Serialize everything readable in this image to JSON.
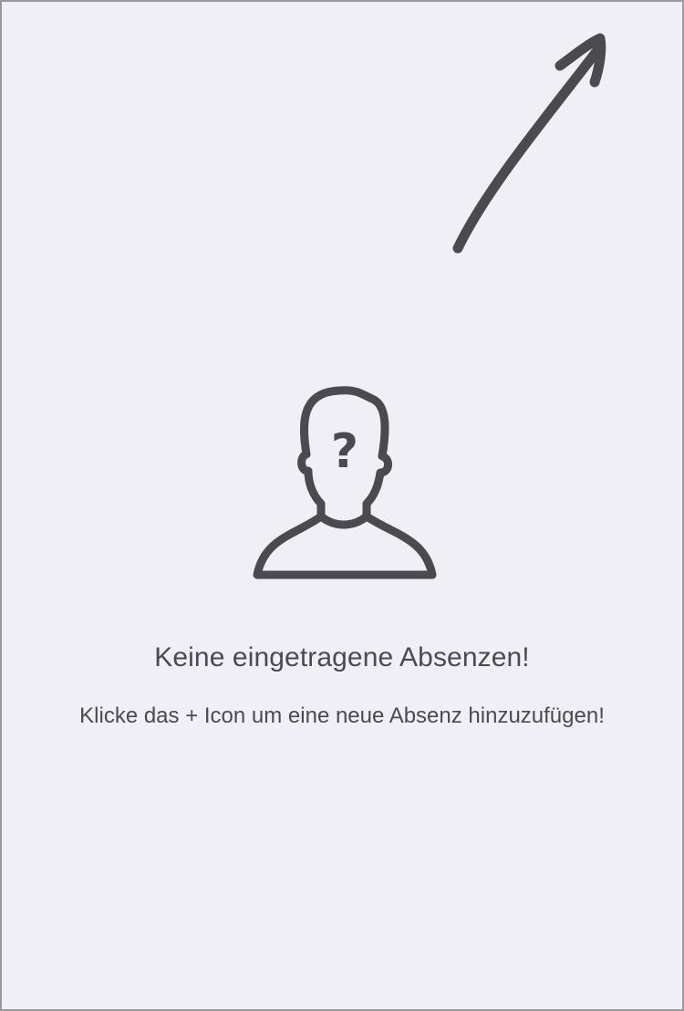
{
  "empty_state": {
    "icon": "unknown-person-icon",
    "icon_glyph": "?",
    "title": "Keine eingetragene Absenzen!",
    "subtitle": "Klicke das + Icon um eine neue Absenz hinzuzufügen!"
  },
  "hint": {
    "icon": "arrow-up-right-icon"
  },
  "colors": {
    "background": "#f0eff5",
    "ink": "#4a4a4f",
    "frame": "#9a9a9e"
  }
}
